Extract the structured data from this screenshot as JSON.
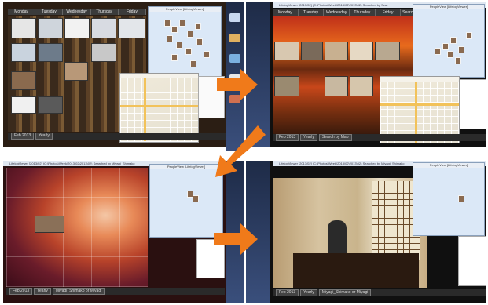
{
  "panels": {
    "top_left": {
      "days": [
        "Monday",
        "Tuesday",
        "Wednesday",
        "Thursday",
        "Friday"
      ],
      "peopleview_title": "PeopleView [LifelogViewer]",
      "bottom": [
        "Feb 2013",
        "Yearly"
      ]
    },
    "top_right": {
      "title": "LifelogViewer [2013/02] (C:\\Photos\\Week\\2013\\02\\2013\\02) Searched by Seat",
      "days": [
        "Monday",
        "Tuesday",
        "Wednesday",
        "Thursday",
        "Friday",
        "Searched by"
      ],
      "peopleview_title": "PeopleView [LifelogViewer]",
      "bottom": [
        "Feb 2013",
        "Yearly",
        "Search by Map"
      ]
    },
    "bottom_left": {
      "title": "LifelogViewer [2013/02] (C:\\Photos\\Week\\2013\\02\\2013\\02) Searched by Miyagi_Shimako",
      "peopleview_title": "PeopleView [LifelogViewer]",
      "bottom": [
        "Feb 2013",
        "Yearly",
        "Miyagi_Shimako or Miyagi"
      ]
    },
    "bottom_right": {
      "title": "LifelogViewer [2013/02] (C:\\Photos\\Week\\2013\\02\\2013\\02) Searched by Miyagi_Shimako",
      "peopleview_title": "PeopleView [LifelogViewer]",
      "bottom": [
        "Feb 2013",
        "Yearly",
        "Miyagi_Shimako or Miyagi"
      ]
    }
  },
  "colors": {
    "arrow": "#f07a1a",
    "accent": "#3b6fb6"
  }
}
